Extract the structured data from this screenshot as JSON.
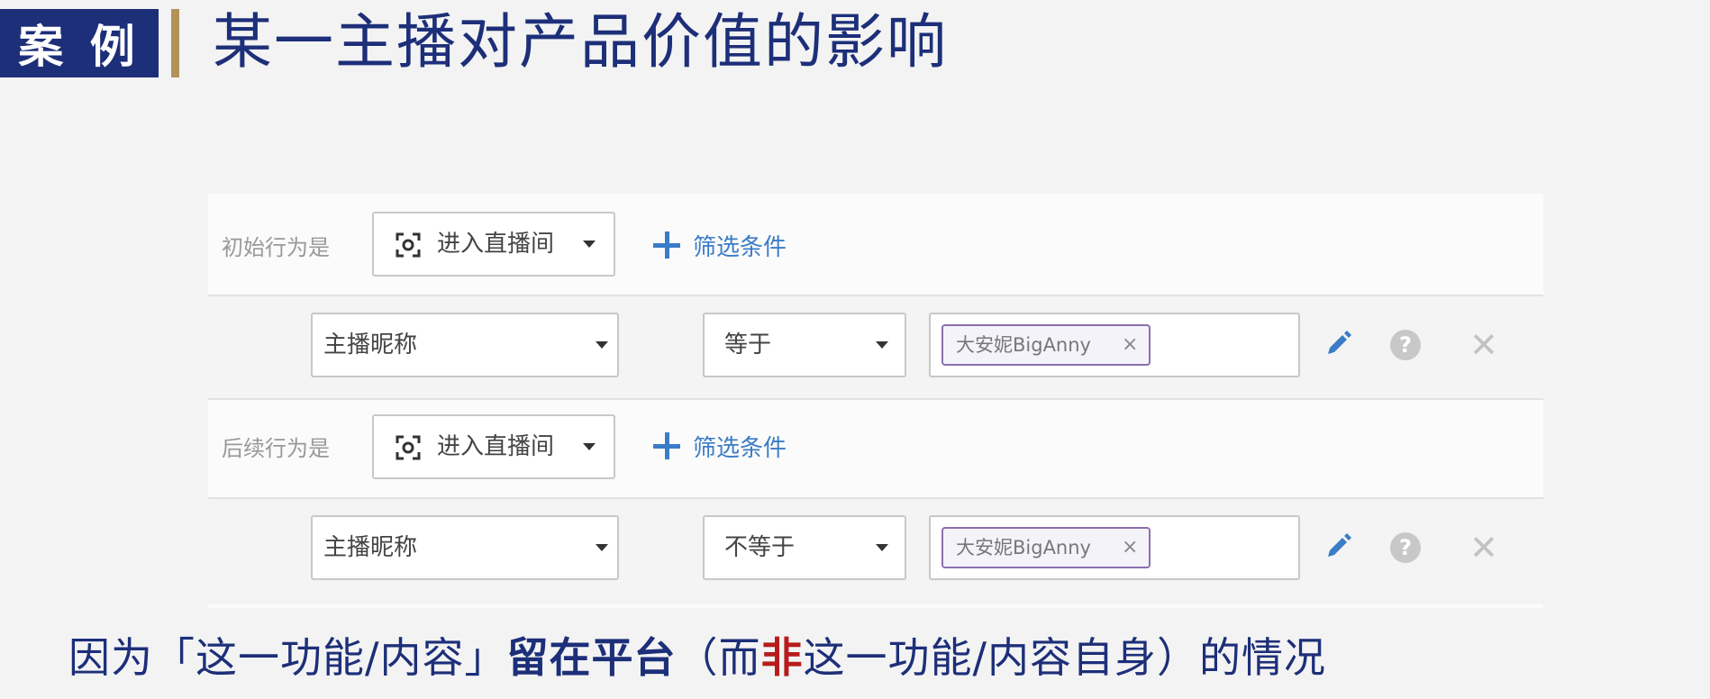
{
  "header": {
    "tag": "案 例",
    "title": "某一主播对产品价值的影响"
  },
  "filter_panel": {
    "initial": {
      "label": "初始行为是",
      "event": "进入直播间",
      "add_filter": "筛选条件",
      "condition": {
        "field": "主播昵称",
        "operator": "等于",
        "value_chip": "大安妮BigAnny",
        "chip_remove": "×"
      }
    },
    "followup": {
      "label": "后续行为是",
      "event": "进入直播间",
      "add_filter": "筛选条件",
      "condition": {
        "field": "主播昵称",
        "operator": "不等于",
        "value_chip": "大安妮BigAnny",
        "chip_remove": "×"
      }
    },
    "icons": [
      "scan-icon",
      "plus-icon",
      "pencil-icon",
      "help-icon",
      "close-icon"
    ]
  },
  "caption": {
    "part1": "因为「这一功能/内容」",
    "part2": "留在平台",
    "part3": "（而",
    "part4": "非",
    "part5": "这一功能/内容自身）的情况"
  },
  "colors": {
    "brand_navy": "#1d2f79",
    "accent_gold": "#b3925a",
    "link_blue": "#3a7cc7",
    "chip_border": "#8c6fae",
    "emphasis_red": "#b71c1c"
  }
}
